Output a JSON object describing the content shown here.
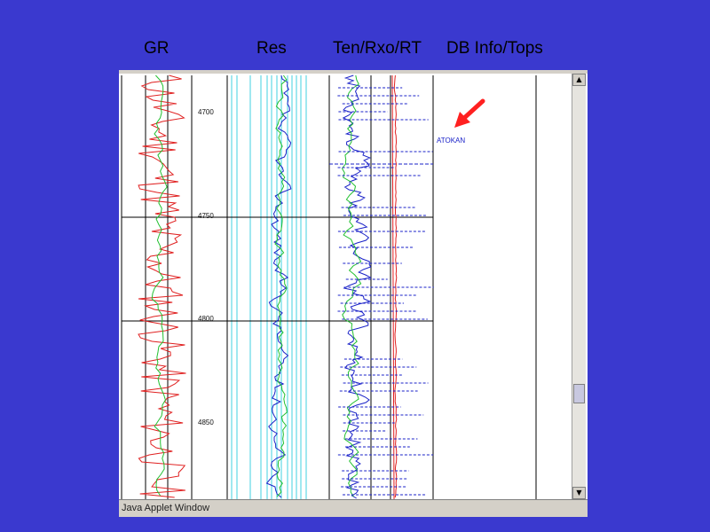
{
  "track_titles": {
    "gr": "GR",
    "res": "Res",
    "ten": "Ten/Rxo/RT",
    "db": "DB Info/Tops"
  },
  "depth_labels": [
    "4700",
    "4750",
    "4800",
    "4850"
  ],
  "formation_top": "ATOKAN",
  "status_bar": "Java Applet Window",
  "scrollbar": {
    "up": "▲",
    "down": "▼"
  },
  "colors": {
    "background": "#3a39cf",
    "gr_curve": "#e02020",
    "res_curve": "#1a22c8",
    "green_curve": "#22c030",
    "grid_cyan": "#40d0e0",
    "arrow": "#ff2020"
  },
  "icons": {
    "arrow": "red-arrow-icon"
  }
}
